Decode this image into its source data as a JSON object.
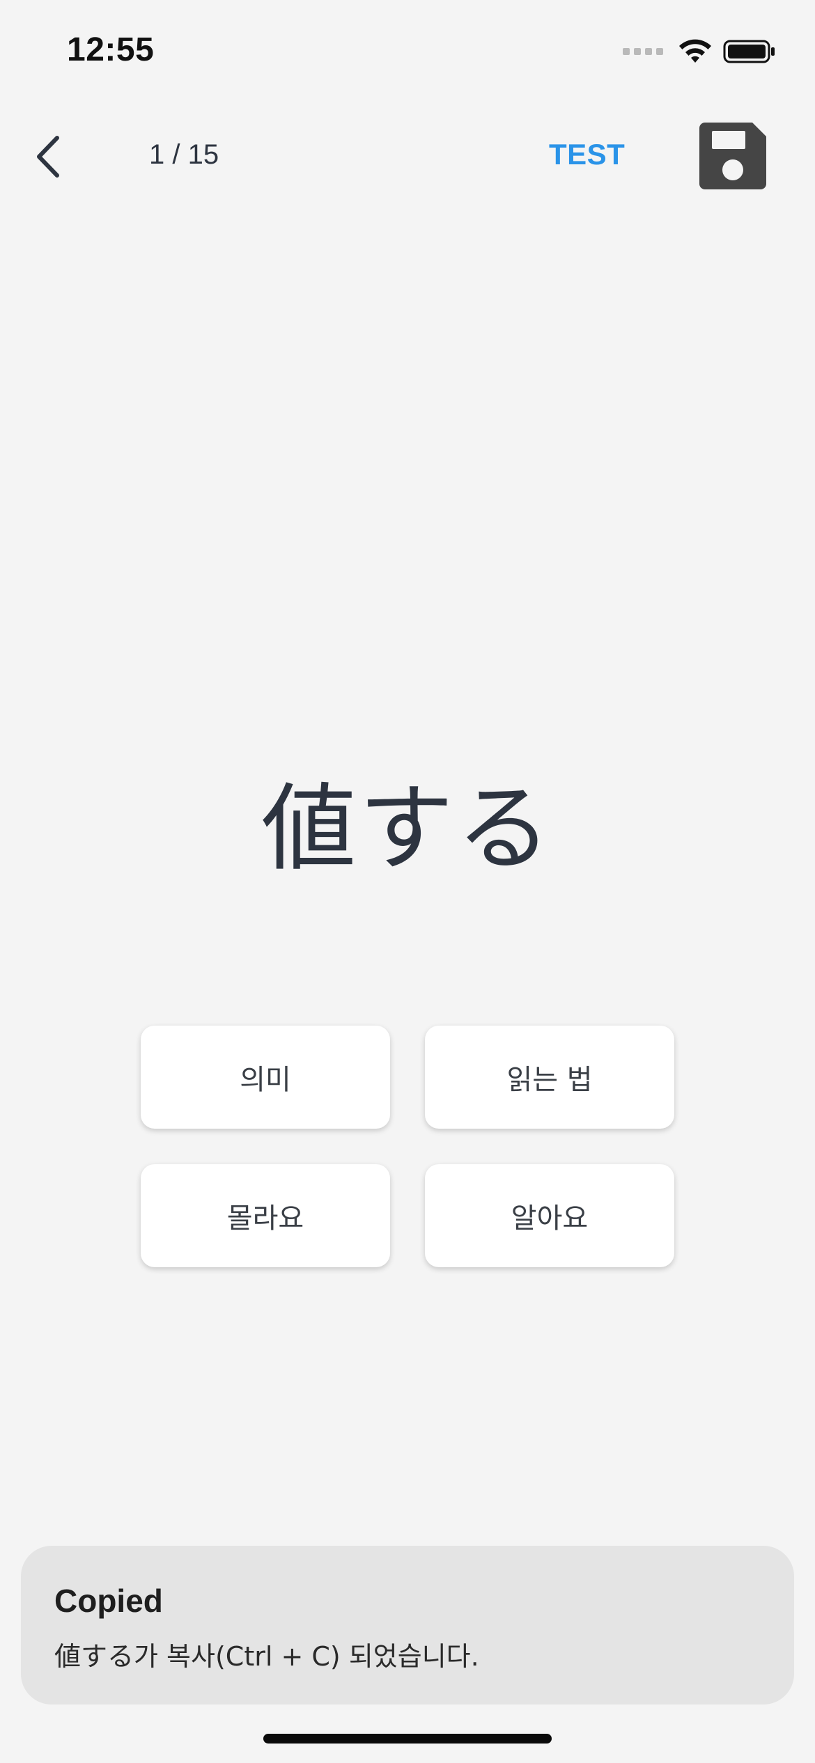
{
  "status_bar": {
    "time": "12:55"
  },
  "nav": {
    "counter": "1 / 15",
    "test_label": "TEST"
  },
  "card": {
    "word": "値する"
  },
  "buttons": {
    "meaning": "의미",
    "reading": "읽는 법",
    "dont_know": "몰라요",
    "know": "알아요"
  },
  "toast": {
    "title": "Copied",
    "message": "値する가 복사(Ctrl + C) 되었습니다."
  },
  "colors": {
    "background": "#f4f4f4",
    "accent": "#2a93e8",
    "text": "#2d3440",
    "toast_background": "#e4e4e4"
  },
  "icons": [
    "back-chevron-icon",
    "save-floppy-icon",
    "wifi-icon",
    "battery-icon",
    "signal-icon"
  ]
}
